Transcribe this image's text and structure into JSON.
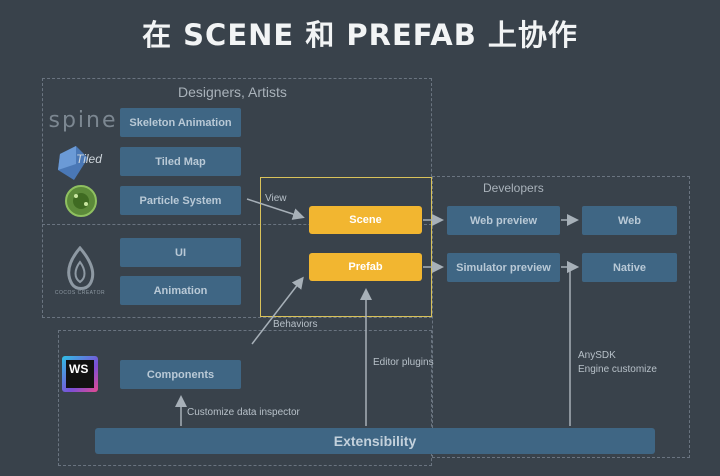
{
  "title": "在 SCENE 和 PREFAB 上协作",
  "designers": {
    "label": "Designers, Artists",
    "tools": [
      "Skeleton Animation",
      "Tiled Map",
      "Particle System",
      "UI",
      "Animation"
    ],
    "logos": {
      "spine": "spine",
      "tiled": "Tiled",
      "particle": "particle-logo-icon",
      "cocos": "COCOS CREATOR"
    }
  },
  "developers": {
    "label": "Developers",
    "scene": "Scene",
    "prefab": "Prefab",
    "web_preview": "Web preview",
    "simulator_preview": "Simulator preview",
    "web": "Web",
    "native": "Native"
  },
  "labels": {
    "view": "View",
    "behaviors": "Behaviors",
    "editor_plugins": "Editor plugins",
    "anysdk": "AnySDK",
    "engine_customize": "Engine customize",
    "customize_data_inspector": "Customize data inspector"
  },
  "components": "Components",
  "ws_logo": "WS",
  "extensibility": "Extensibility",
  "colors": {
    "background": "#39424b",
    "box": "#3f6684",
    "highlight": "#f2b630",
    "frame": "#d9c25a"
  }
}
